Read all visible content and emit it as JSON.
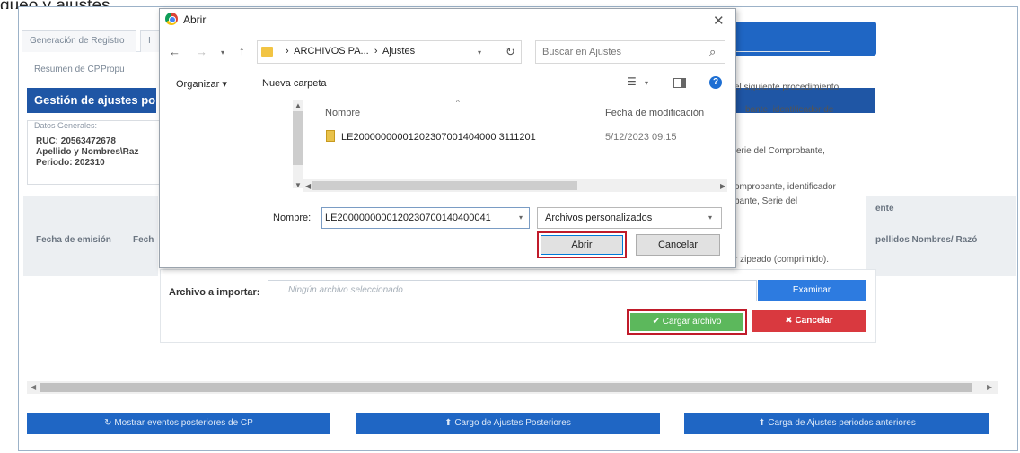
{
  "top_fragment": "queo y ajustes",
  "background": {
    "tabs": [
      "Generación de Registro",
      "I"
    ],
    "subtabs": [
      "Resumen de CP",
      "Propu"
    ],
    "section_title": "Gestión de ajustes po",
    "datos": {
      "legend": "Datos Generales:",
      "ruc": "RUC: 20563472678",
      "apellido": "Apellido y Nombres\\Raz",
      "periodo": "Periodo: 202310"
    },
    "grid_headers": {
      "fecha_emision": "Fecha de emisión",
      "fecha_trunc": "Fech",
      "apellidos": "pellidos Nombres/ Razó",
      "ente": "ente"
    },
    "procedure": [
      "el siguiente procedimiento:",
      "bante, identificador de",
      "erie del Comprobante,",
      "omprobante, identificador",
      "bante, Serie del",
      "r zipeado (comprimido)."
    ],
    "import": {
      "label": "Archivo a importar:",
      "placeholder": "Ningún archivo seleccionado",
      "examinar": "Examinar",
      "cargar": "✔ Cargar archivo",
      "cancelar": "✖ Cancelar"
    },
    "bottom_buttons": [
      "↻ Mostrar eventos posteriores de CP",
      "⬆ Cargo de Ajustes Posteriores",
      "⬆ Carga de Ajustes periodos anteriores"
    ]
  },
  "dialog": {
    "title": "Abrir",
    "close": "✕",
    "path": [
      "ARCHIVOS PA...",
      "Ajustes"
    ],
    "search_placeholder": "Buscar en Ajustes",
    "organizar": "Organizar ▾",
    "nueva_carpeta": "Nueva carpeta",
    "col_nombre": "Nombre",
    "col_fecha": "Fecha de modificación",
    "files": [
      {
        "name": "LE20000000001202307001404000 3111201",
        "date": "5/12/2023 09:15"
      }
    ],
    "nombre_label": "Nombre:",
    "nombre_value": "LE2000000000120230700140400041",
    "filter": "Archivos personalizados",
    "abrir": "Abrir",
    "cancelar": "Cancelar"
  }
}
